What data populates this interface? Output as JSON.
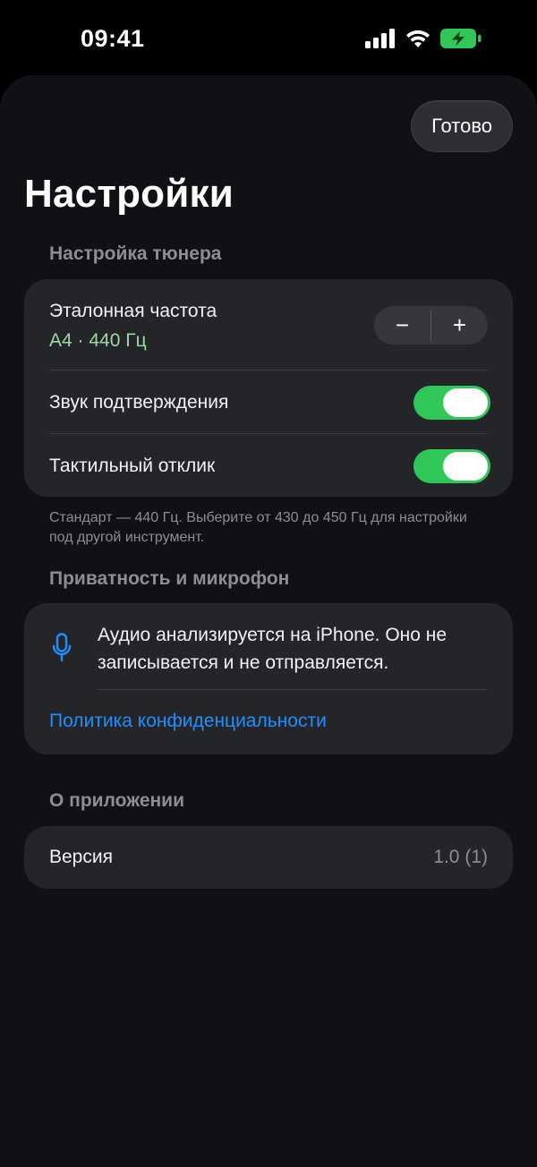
{
  "status_bar": {
    "time": "09:41",
    "icons": [
      "cellular-signal-icon",
      "wifi-icon",
      "battery-charging-icon"
    ],
    "battery_color": "#30c759"
  },
  "toolbar": {
    "done_label": "Готово"
  },
  "page": {
    "title": "Настройки"
  },
  "tuner_section": {
    "header": "Настройка тюнера",
    "reference_frequency": {
      "label": "Эталонная частота",
      "value": "A4 · 440 Гц",
      "value_color": "#9ed9a3",
      "decrement_label": "−",
      "increment_label": "+"
    },
    "confirmation_sound": {
      "label": "Звук подтверждения",
      "enabled": true
    },
    "haptic_feedback": {
      "label": "Тактильный отклик",
      "enabled": true
    },
    "footnote": "Стандарт — 440 Гц. Выберите от 430 до 450 Гц для настройки под другой инструмент."
  },
  "privacy_section": {
    "header": "Приватность и микрофон",
    "icon": "microphone-icon",
    "description": "Аудио анализируется на iPhone. Оно не записывается и не отправляется.",
    "policy_link": "Политика конфиденциальности"
  },
  "about_section": {
    "header": "О приложении",
    "version_label": "Версия",
    "version_value": "1.0 (1)"
  },
  "colors": {
    "accent": "#1f8fff",
    "toggle_on": "#30c759",
    "card_bg": "#242528",
    "sheet_bg": "#0f1114"
  }
}
